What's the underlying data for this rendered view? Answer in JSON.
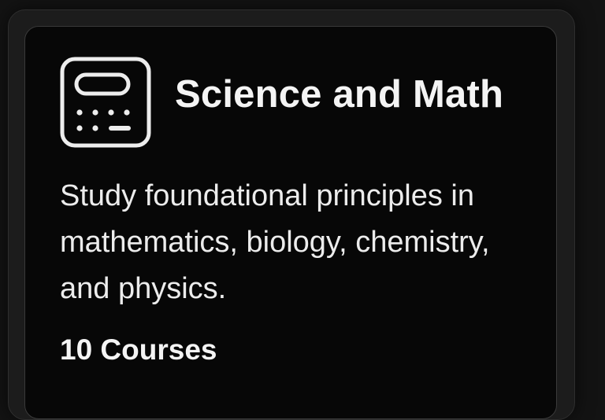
{
  "card": {
    "icon": "calculator-icon",
    "title": "Science and Math",
    "description": "Study foundational principles in mathematics, biology, chemistry, and physics.",
    "course_count": "10 Courses"
  },
  "colors": {
    "background": "#131313",
    "card_background": "#070707",
    "text": "#f4f4f4"
  }
}
